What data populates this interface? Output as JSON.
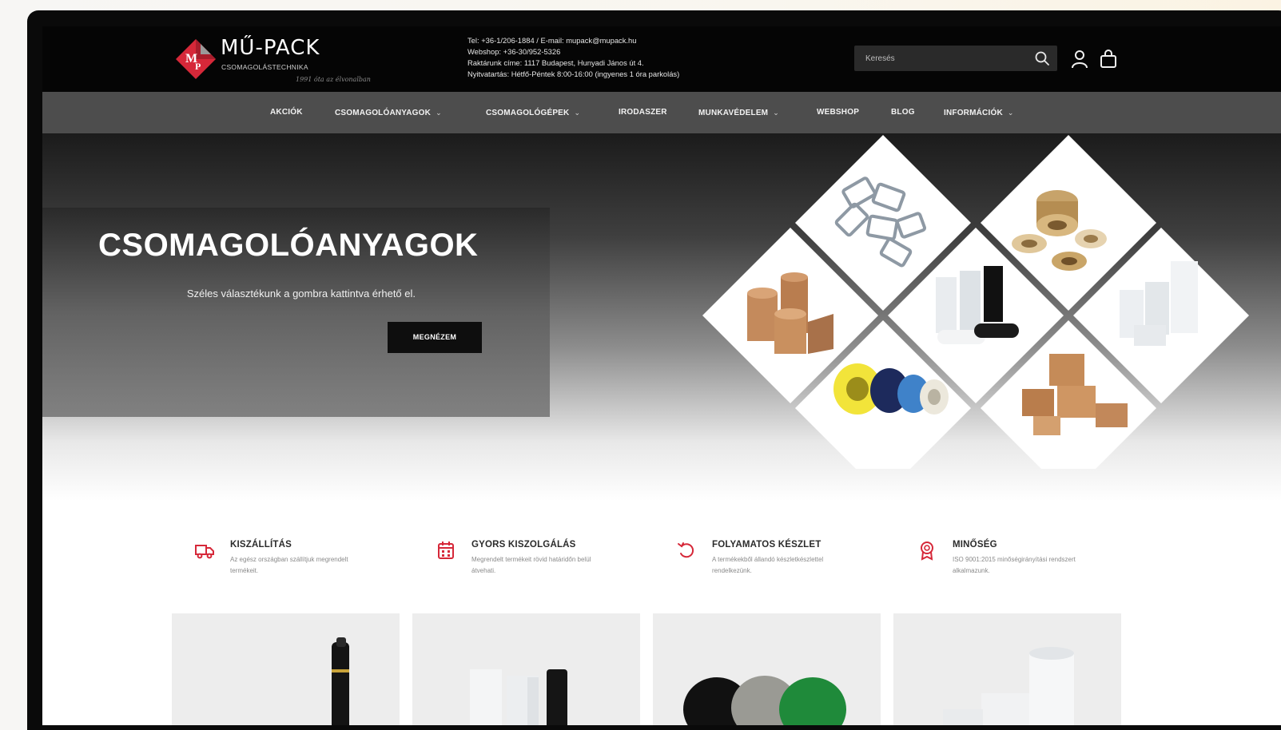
{
  "header": {
    "logo": {
      "title": "MŰ-PACK",
      "subtitle": "CSOMAGOLÁSTECHNIKA",
      "tagline": "1991 óta az élvonalban"
    },
    "contact_lines": [
      "Tel: +36-1/206-1884 / E-mail: mupack@mupack.hu",
      "Webshop: +36-30/952-5326",
      "Raktárunk címe: 1117 Budapest, Hunyadi János út 4.",
      "Nyitvatartás: Hétfő-Péntek 8:00-16:00 (ingyenes 1 óra parkolás)"
    ],
    "search": {
      "placeholder": "Keresés"
    },
    "icons": {
      "search": "search-icon",
      "account": "user-icon",
      "cart": "shopping-bag-icon"
    }
  },
  "nav": {
    "items": [
      {
        "label": "AKCIÓK",
        "has_dropdown": false
      },
      {
        "label": "CSOMAGOLÓANYAGOK",
        "has_dropdown": true
      },
      {
        "label": "CSOMAGOLÓGÉPEK",
        "has_dropdown": true
      },
      {
        "label": "IRODASZER",
        "has_dropdown": false
      },
      {
        "label": "MUNKAVÉDELEM",
        "has_dropdown": true
      },
      {
        "label": "WEBSHOP",
        "has_dropdown": false
      },
      {
        "label": "BLOG",
        "has_dropdown": false
      },
      {
        "label": "INFORMÁCIÓK",
        "has_dropdown": true
      }
    ],
    "chevron": "⌄"
  },
  "hero": {
    "title": "CSOMAGOLÓANYAGOK",
    "subtitle": "Széles választékunk a gombra kattintva érhető el.",
    "cta_label": "MEGNÉZEM"
  },
  "features": [
    {
      "icon": "truck-icon",
      "title": "KISZÁLLÍTÁS",
      "text": "Az egész országban szállítjuk megrendelt termékeit."
    },
    {
      "icon": "calendar-icon",
      "title": "GYORS KISZOLGÁLÁS",
      "text": "Megrendelt termékeit rövid határidőn belül átvehati."
    },
    {
      "icon": "refresh-icon",
      "title": "FOLYAMATOS KÉSZLET",
      "text": "A termékekből állandó készletkészlettel rendelkezünk."
    },
    {
      "icon": "award-icon",
      "title": "MINŐSÉG",
      "text": "ISO 9001:2015 minőségirányítási rendszert alkalmazunk."
    }
  ],
  "colors": {
    "topbar": "#050505",
    "nav": "#4d4d4d",
    "accent": "#d62839",
    "text_dark": "#2b2b2b"
  }
}
